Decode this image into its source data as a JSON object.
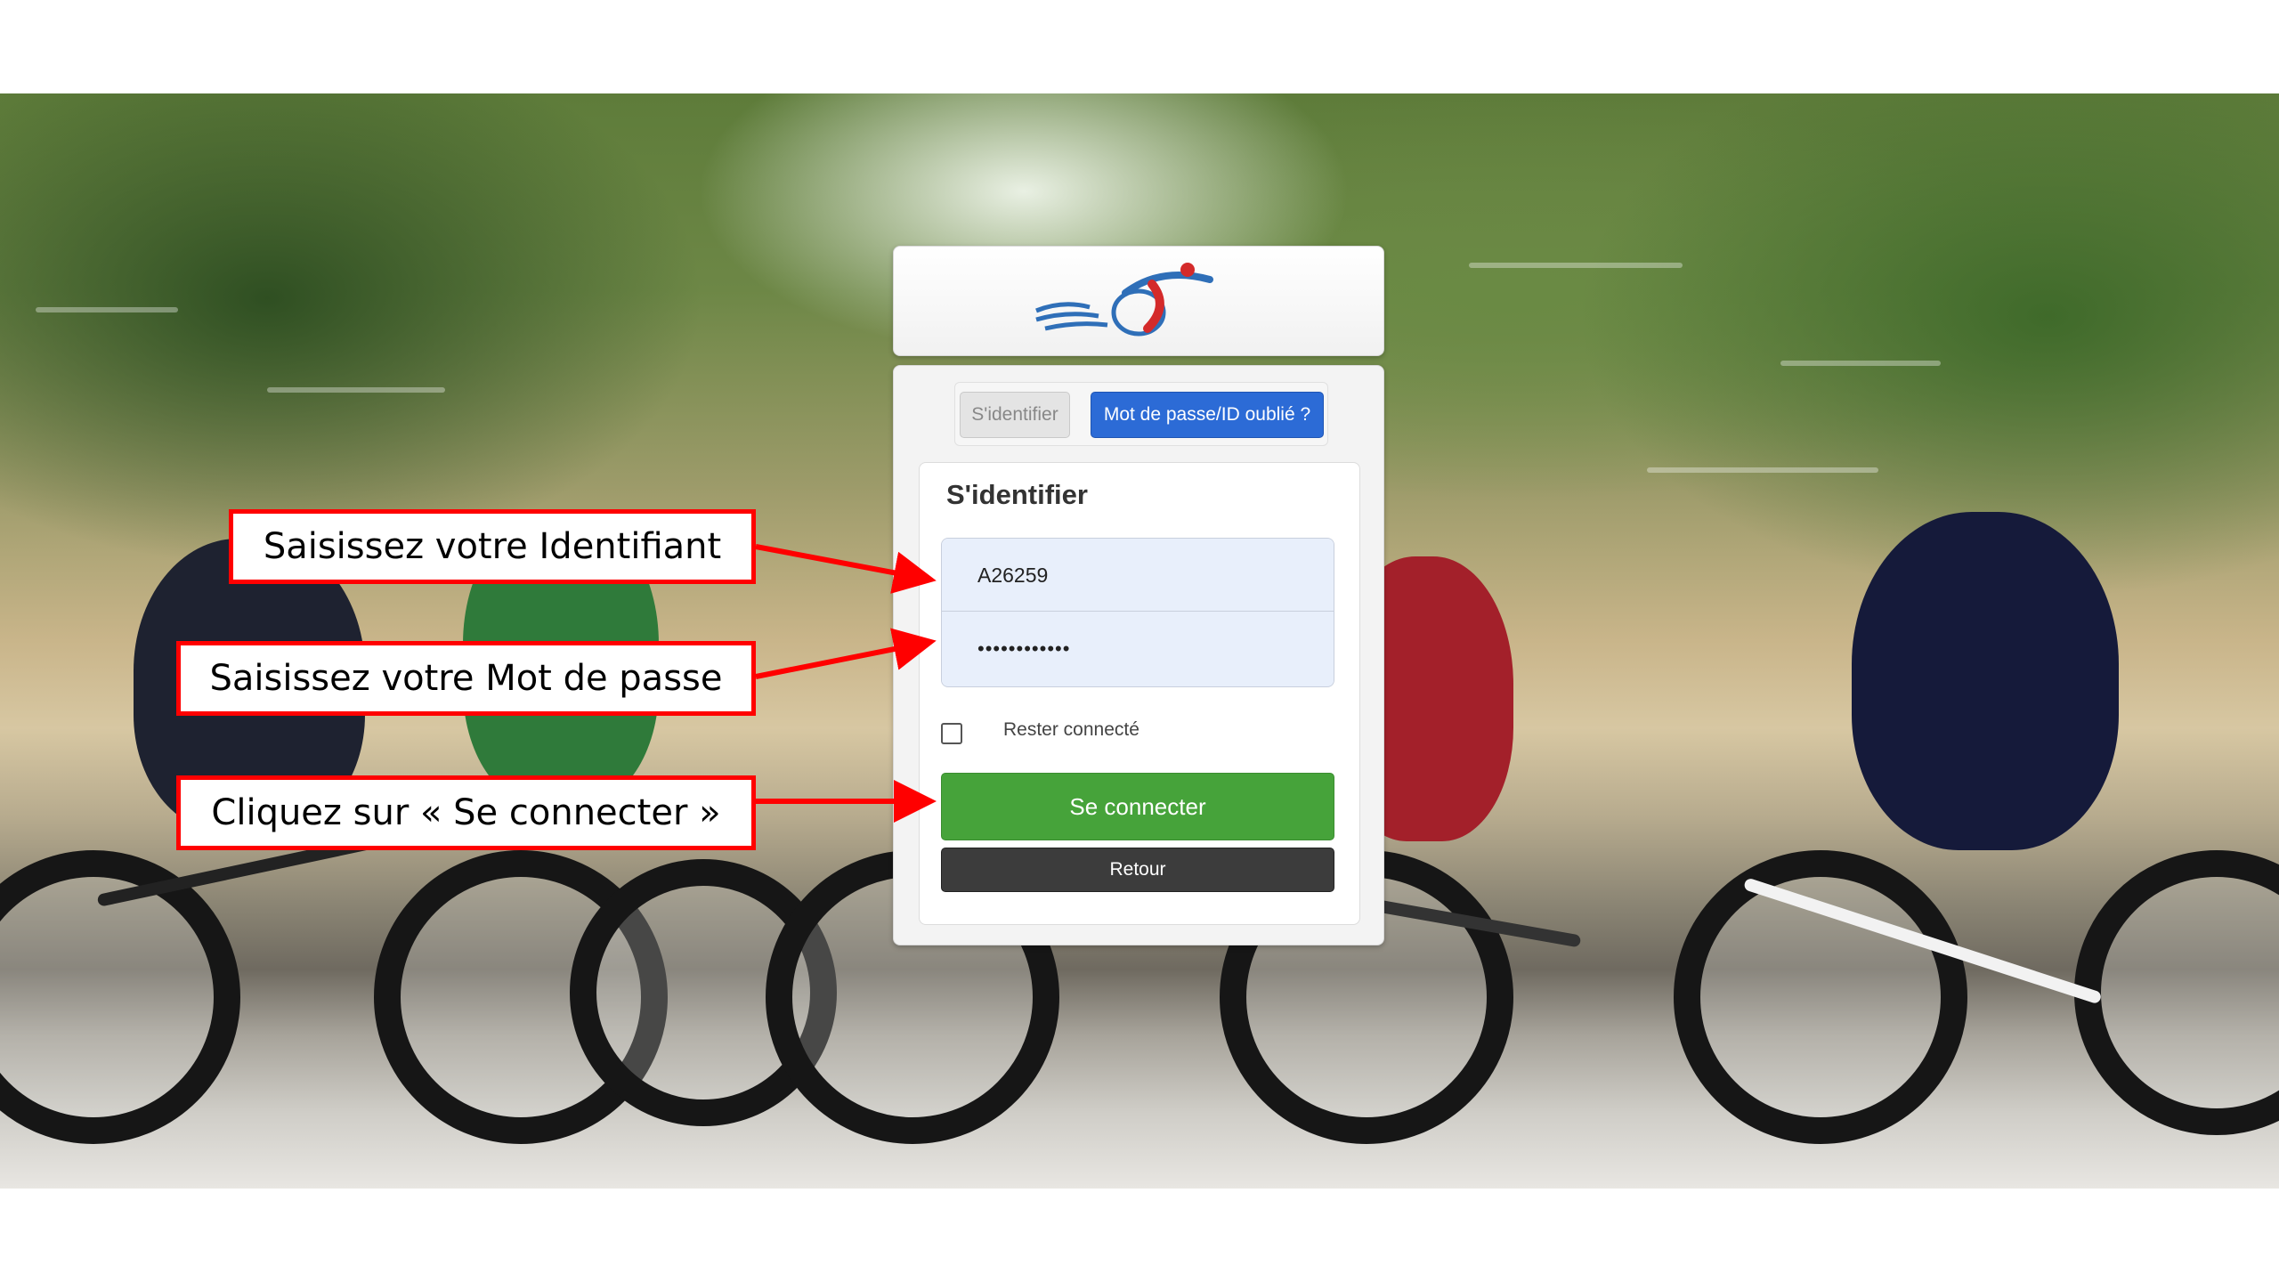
{
  "login": {
    "tabs": {
      "identify": "S'identifier",
      "forgot": "Mot de passe/ID oublié ?"
    },
    "form": {
      "title": "S'identifier",
      "identifier_value": "A26259",
      "password_value": "••••••••••••",
      "remember_label": "Rester connecté",
      "remember_checked": false,
      "connect_button": "Se connecter",
      "back_button": "Retour"
    },
    "colors": {
      "forgot_tab": "#2c6bd6",
      "connect_button": "#46a33a",
      "back_button": "#3c3c3c",
      "field_background": "#e8effb"
    },
    "logo_icon": "triathlon-cyclist-logo-icon"
  },
  "callouts": {
    "identifier": "Saisissez votre Identifiant",
    "password": "Saisissez votre Mot de passe",
    "connect": "Cliquez sur « Se connecter »",
    "border_color": "#ff0000"
  }
}
